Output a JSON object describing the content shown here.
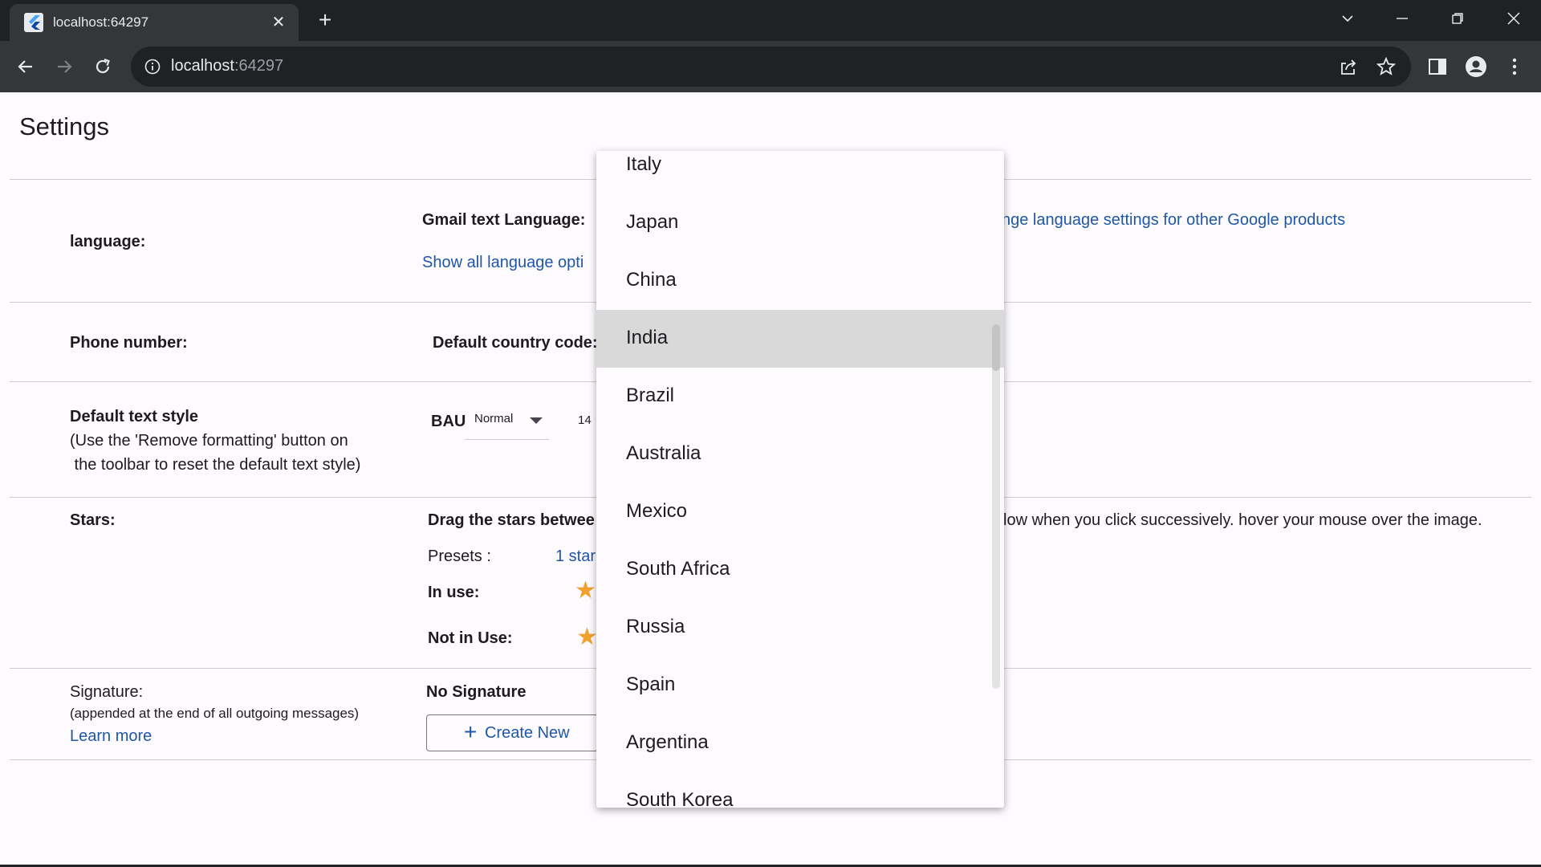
{
  "browser": {
    "tab_title": "localhost:64297",
    "url_host": "localhost",
    "url_port": ":64297"
  },
  "page": {
    "title": "Settings"
  },
  "language": {
    "label": "language:",
    "gmail_text_language": "Gmail text Language:",
    "show_all_link": "Show all language opti",
    "change_link": "nge language settings for other Google products"
  },
  "phone": {
    "label": "Phone number:",
    "default_country_code": "Default country code:"
  },
  "text_style": {
    "label": "Default text style",
    "note_line1": "(Use the 'Remove formatting' button on",
    "note_line2": " the toolbar to reset the default text style)",
    "bau": "BAU",
    "font_value": "Normal",
    "size_value": "14"
  },
  "stars": {
    "label": "Stars:",
    "drag_text_left": "Drag the stars betwee",
    "drag_text_right": "low when you click successively. hover your mouse over the image.",
    "presets_label": "Presets :",
    "preset_link": "1 star",
    "in_use_label": "In use:",
    "not_in_use_label": "Not in Use:",
    "star_color": "#f2a12e"
  },
  "signature": {
    "label": "Signature:",
    "note": "(appended at the end of all outgoing messages)",
    "learn_more": "Learn more",
    "no_signature": "No Signature",
    "create_new": "Create New"
  },
  "country_dropdown": {
    "items": [
      "Italy",
      "Japan",
      "China",
      "India",
      "Brazil",
      "Australia",
      "Mexico",
      "South Africa",
      "Russia",
      "Spain",
      "Argentina",
      "South Korea"
    ],
    "selected": "India"
  }
}
